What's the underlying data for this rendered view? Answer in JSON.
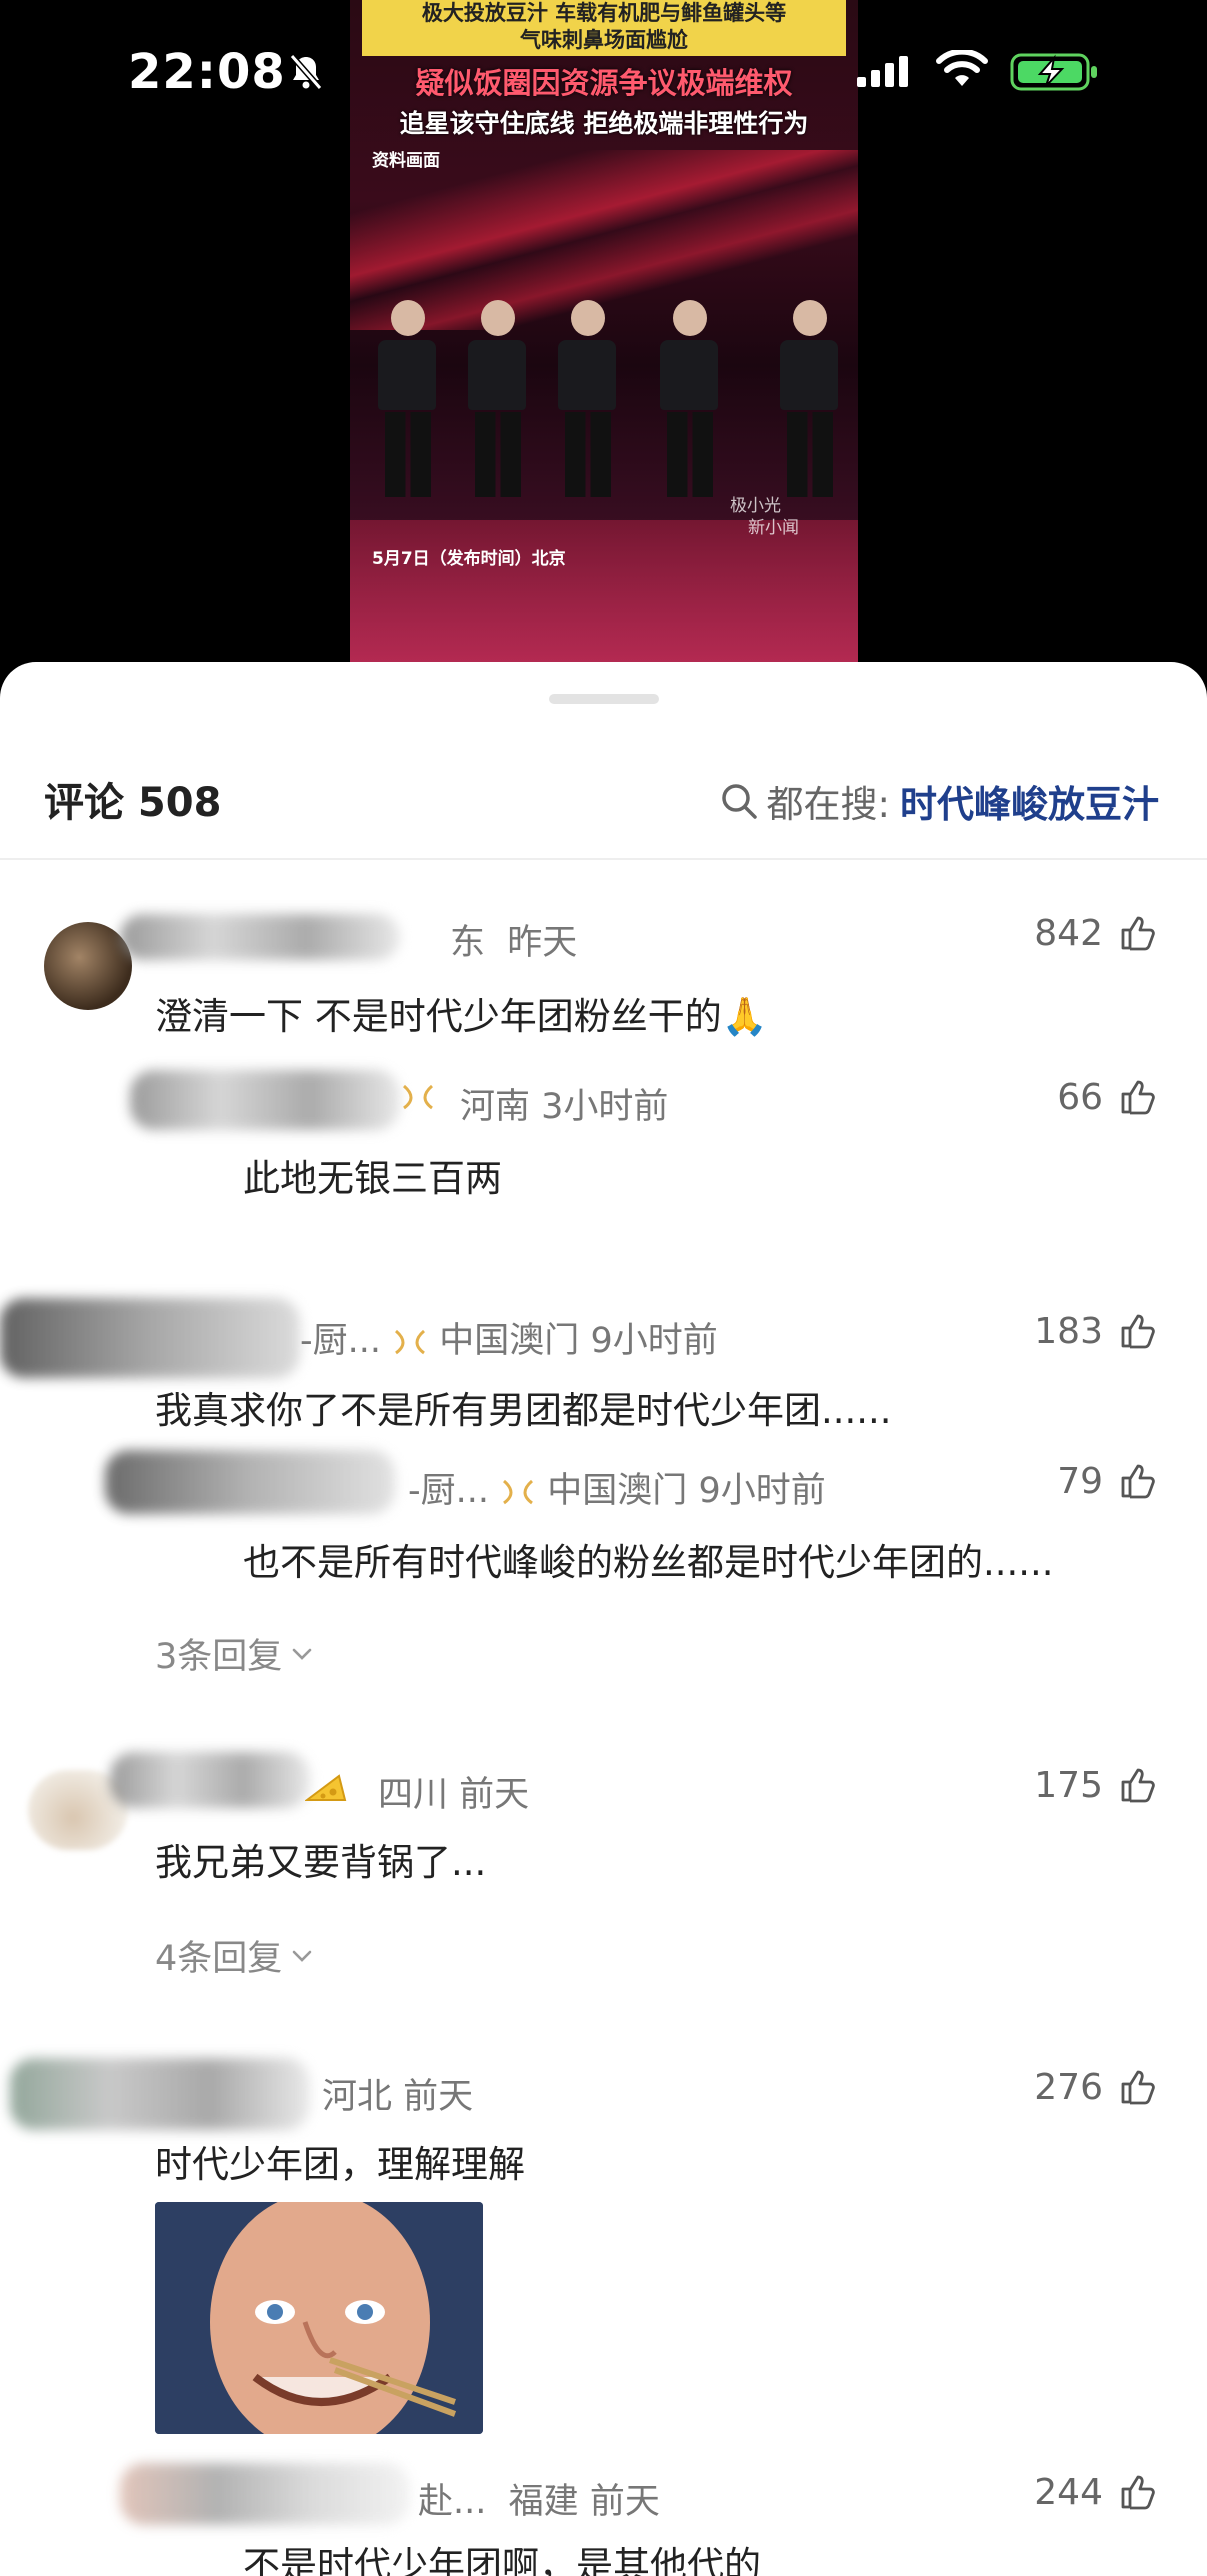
{
  "status_bar": {
    "time": "22:08"
  },
  "video": {
    "banner_top": "极大投放豆汁 车载有机肥与鲱鱼罐头等",
    "banner_top2": "气味刺鼻场面尴尬",
    "headline": "疑似饭圈因资源争议极端维权",
    "subline": "追星该守住底线 拒绝极端非理性行为",
    "material_label": "资料画面",
    "caption": "5月7日（发布时间）北京",
    "watermark_1": "极小光",
    "watermark_2": "新小闻"
  },
  "header": {
    "title": "评论 508",
    "search_prefix": "都在搜:",
    "search_term": "时代峰峻放豆汁"
  },
  "comments": [
    {
      "name_suffix": "东",
      "time": "昨天",
      "likes": "842",
      "text": "澄清一下 不是时代少年团粉丝干的🙏",
      "reply": {
        "location": "河南",
        "time": "3小时前",
        "likes": "66",
        "text": "此地无银三百两"
      }
    },
    {
      "name_suffix": "-厨...",
      "location": "中国澳门",
      "time": "9小时前",
      "likes": "183",
      "text": "我真求你了不是所有男团都是时代少年团......",
      "reply": {
        "name_suffix": "-厨...",
        "location": "中国澳门",
        "time": "9小时前",
        "likes": "79",
        "text": "也不是所有时代峰峻的粉丝都是时代少年团的......"
      },
      "more_replies": "3条回复"
    },
    {
      "location": "四川",
      "time": "前天",
      "likes": "175",
      "text": "我兄弟又要背锅了...",
      "more_replies": "4条回复"
    },
    {
      "location": "河北",
      "time": "前天",
      "likes": "276",
      "text": "时代少年团，理解理解",
      "reply": {
        "name_suffix": "赴...",
        "location": "福建",
        "time": "前天",
        "likes": "244",
        "text": "不是时代少年团啊，是其他代的"
      }
    }
  ],
  "colors": {
    "accent": "#1f3f8c",
    "meta": "#777777",
    "text": "#222222"
  }
}
